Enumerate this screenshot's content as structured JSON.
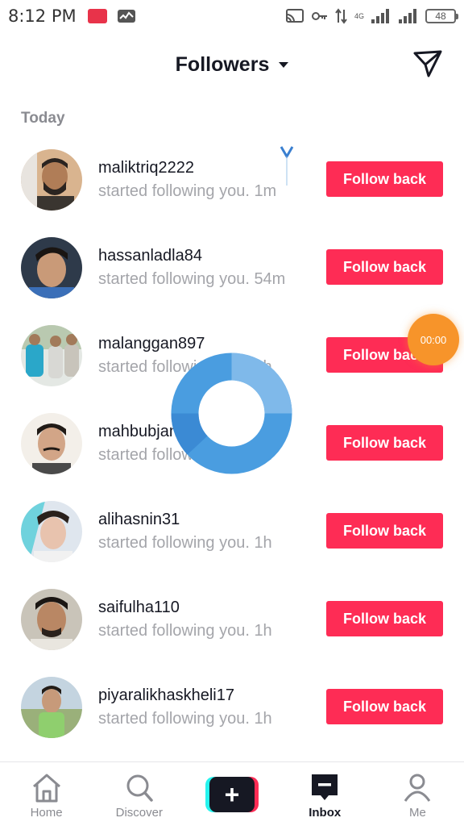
{
  "status_bar": {
    "time": "8:12 PM",
    "network": "4G",
    "battery": "48"
  },
  "header": {
    "title": "Followers"
  },
  "section_label": "Today",
  "followers": [
    {
      "username": "maliktriq2222",
      "subtext": "started following you. 1m",
      "button": "Follow back"
    },
    {
      "username": "hassanladla84",
      "subtext": "started following you. 54m",
      "button": "Follow back"
    },
    {
      "username": "malanggan897",
      "subtext": "started following you. 1h",
      "button": "Follow back"
    },
    {
      "username": "mahbubjan_o",
      "subtext": "started following you. 1h",
      "button": "Follow back"
    },
    {
      "username": "alihasnin31",
      "subtext": "started following you. 1h",
      "button": "Follow back"
    },
    {
      "username": "saifulha110",
      "subtext": "started following you. 1h",
      "button": "Follow back"
    },
    {
      "username": "piyaralikhaskheli17",
      "subtext": "started following you. 1h",
      "button": "Follow back"
    }
  ],
  "recording_timer": "00:00",
  "bottom_nav": {
    "home": "Home",
    "discover": "Discover",
    "inbox": "Inbox",
    "me": "Me"
  },
  "colors": {
    "accent": "#fe2c55",
    "spinner": "#4a9de0",
    "timer": "#f7942a"
  }
}
